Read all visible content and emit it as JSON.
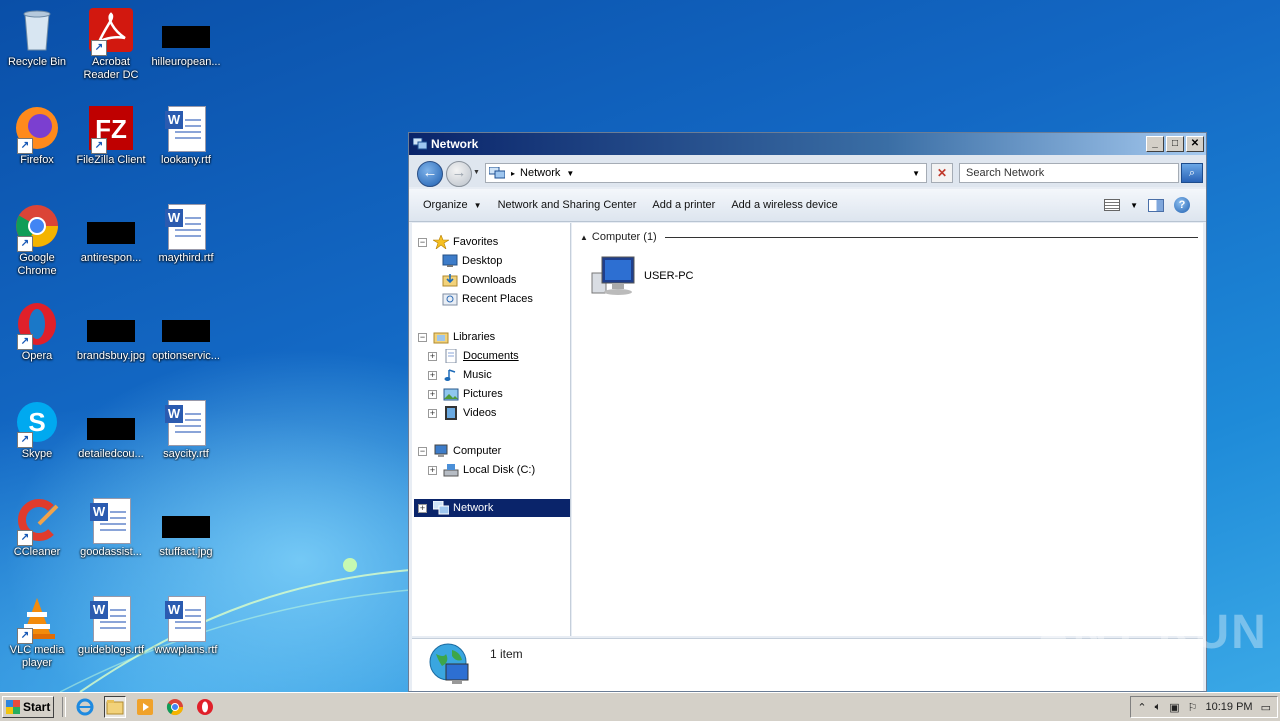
{
  "desktop": {
    "icons": [
      {
        "label": "Recycle Bin"
      },
      {
        "label": "Acrobat Reader DC"
      },
      {
        "label": "hilleuropean..."
      },
      {
        "label": "Firefox"
      },
      {
        "label": "FileZilla Client"
      },
      {
        "label": "lookany.rtf"
      },
      {
        "label": "Google Chrome"
      },
      {
        "label": "antirespon..."
      },
      {
        "label": "maythird.rtf"
      },
      {
        "label": "Opera"
      },
      {
        "label": "brandsbuy.jpg"
      },
      {
        "label": "optionservic..."
      },
      {
        "label": "Skype"
      },
      {
        "label": "detailedcou..."
      },
      {
        "label": "saycity.rtf"
      },
      {
        "label": "CCleaner"
      },
      {
        "label": "goodassist..."
      },
      {
        "label": "stuffact.jpg"
      },
      {
        "label": "VLC media player"
      },
      {
        "label": "guideblogs.rtf"
      },
      {
        "label": "wwwplans.rtf"
      }
    ]
  },
  "window": {
    "title": "Network",
    "address": "Network",
    "search_placeholder": "Search Network",
    "toolbar": {
      "organize": "Organize",
      "sharing": "Network and Sharing Center",
      "printer": "Add a printer",
      "wireless": "Add a wireless device"
    },
    "nav": {
      "favorites": "Favorites",
      "desktop": "Desktop",
      "downloads": "Downloads",
      "recent": "Recent Places",
      "libraries": "Libraries",
      "documents": "Documents",
      "music": "Music",
      "pictures": "Pictures",
      "videos": "Videos",
      "computer": "Computer",
      "local_disk": "Local Disk (C:)",
      "network": "Network"
    },
    "group_header": "Computer (1)",
    "items": [
      {
        "label": "USER-PC"
      }
    ],
    "status": "1 item"
  },
  "taskbar": {
    "start": "Start",
    "clock": "10:19 PM"
  },
  "watermark": "ANY RUN"
}
